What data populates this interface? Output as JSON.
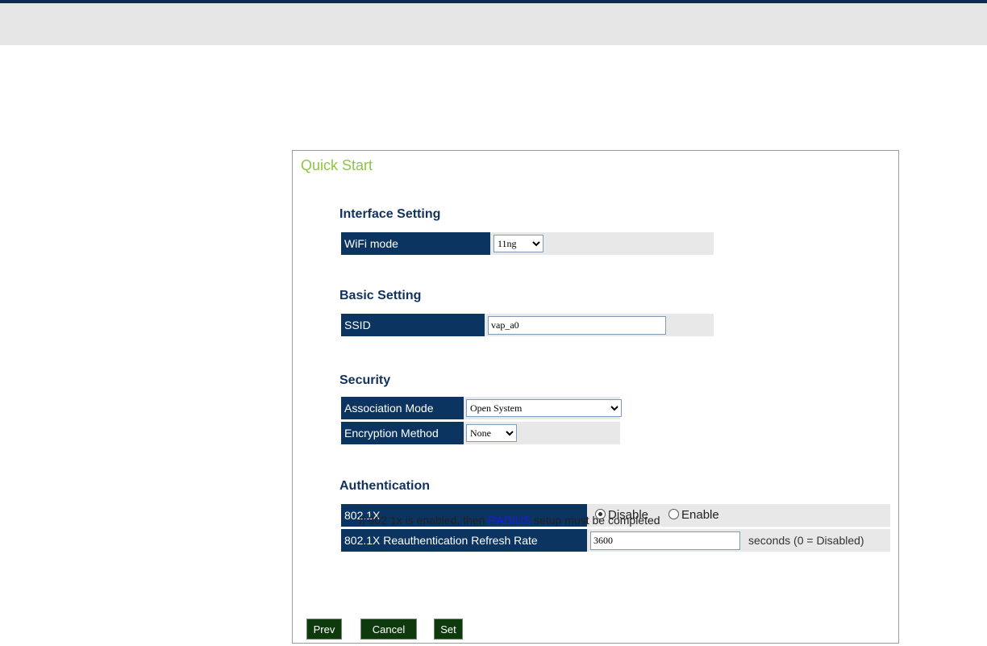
{
  "panel": {
    "title": "Quick Start"
  },
  "interface": {
    "title": "Interface Setting",
    "wifi_mode_label": "WiFi mode",
    "wifi_mode_value": "11ng"
  },
  "basic": {
    "title": "Basic Setting",
    "ssid_label": "SSID",
    "ssid_value": "vap_a0"
  },
  "security": {
    "title": "Security",
    "assoc_label": "Association Mode",
    "assoc_value": "Open System",
    "enc_label": "Encryption Method",
    "enc_value": "None"
  },
  "auth": {
    "title": "Authentication",
    "dot1x_label": "802.1X",
    "disable_label": "Disable",
    "enable_label": "Enable",
    "selected": "Disable",
    "reauth_label": "802.1X Reauthentication Refresh Rate",
    "reauth_value": "3600",
    "reauth_suffix": "seconds (0 = Disabled)"
  },
  "note": {
    "prefix": "If 802.1x is enabled, then ",
    "link": "RADIUS",
    "suffix": " setup must be completed"
  },
  "buttons": {
    "prev": "Prev",
    "cancel": "Cancel",
    "set": "Set"
  },
  "colors": {
    "label_bg": "#0b3460",
    "title_green": "#8cc63f",
    "button_bg": "#0e3a0e"
  }
}
